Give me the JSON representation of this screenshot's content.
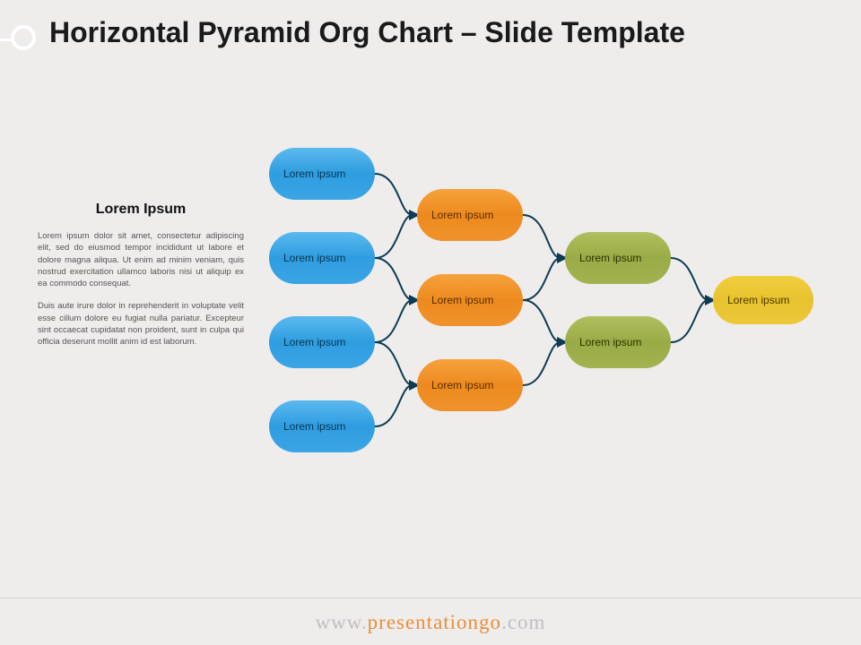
{
  "title": "Horizontal Pyramid Org Chart – Slide Template",
  "sidebar": {
    "title": "Lorem Ipsum",
    "para1": "Lorem ipsum dolor sit amet, consectetur adipiscing elit, sed do eiusmod tempor incididunt ut labore et dolore magna aliqua. Ut enim ad minim veniam, quis nostrud exercitation ullamco laboris nisi ut aliquip ex ea commodo consequat.",
    "para2": "Duis aute irure dolor in reprehenderit in voluptate velit esse cillum dolore eu fugiat nulla pariatur. Excepteur sint occaecat cupidatat non proident, sunt in culpa qui officia deserunt mollit anim id est laborum."
  },
  "chart_data": {
    "type": "org_chart_horizontal",
    "levels": [
      {
        "color": "blue",
        "nodes": [
          "Lorem ipsum",
          "Lorem ipsum",
          "Lorem ipsum",
          "Lorem ipsum"
        ]
      },
      {
        "color": "orange",
        "nodes": [
          "Lorem ipsum",
          "Lorem ipsum",
          "Lorem ipsum"
        ]
      },
      {
        "color": "green",
        "nodes": [
          "Lorem ipsum",
          "Lorem ipsum"
        ]
      },
      {
        "color": "yellow",
        "nodes": [
          "Lorem ipsum"
        ]
      }
    ]
  },
  "footer": {
    "prefix": "www.",
    "accent": "presentationgo",
    "suffix": ".com"
  }
}
